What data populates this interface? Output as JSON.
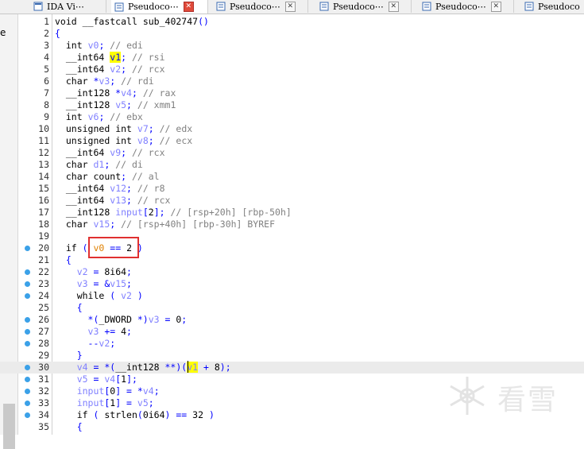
{
  "tabs": [
    {
      "label": "IDA Vi⋯",
      "active": false
    },
    {
      "label": "Pseudoco⋯",
      "active": true
    },
    {
      "label": "Pseudoco⋯",
      "active": false
    },
    {
      "label": "Pseudoco⋯",
      "active": false
    },
    {
      "label": "Pseudoco⋯",
      "active": false
    },
    {
      "label": "Pseudoco",
      "active": false
    }
  ],
  "left_panel_label": "e",
  "watermark": "看雪",
  "lines": [
    {
      "n": "1",
      "bp": false,
      "text": "void __fastcall sub_402747()"
    },
    {
      "n": "2",
      "bp": false,
      "text": "{"
    },
    {
      "n": "3",
      "bp": false,
      "text": "  int v0; // edi"
    },
    {
      "n": "4",
      "bp": false,
      "text": "  __int64 v1; // rsi"
    },
    {
      "n": "5",
      "bp": false,
      "text": "  __int64 v2; // rcx"
    },
    {
      "n": "6",
      "bp": false,
      "text": "  char *v3; // rdi"
    },
    {
      "n": "7",
      "bp": false,
      "text": "  __int128 *v4; // rax"
    },
    {
      "n": "8",
      "bp": false,
      "text": "  __int128 v5; // xmm1"
    },
    {
      "n": "9",
      "bp": false,
      "text": "  int v6; // ebx"
    },
    {
      "n": "10",
      "bp": false,
      "text": "  unsigned int v7; // edx"
    },
    {
      "n": "11",
      "bp": false,
      "text": "  unsigned int v8; // ecx"
    },
    {
      "n": "12",
      "bp": false,
      "text": "  __int64 v9; // rcx"
    },
    {
      "n": "13",
      "bp": false,
      "text": "  char d1; // di"
    },
    {
      "n": "14",
      "bp": false,
      "text": "  char count; // al"
    },
    {
      "n": "15",
      "bp": false,
      "text": "  __int64 v12; // r8"
    },
    {
      "n": "16",
      "bp": false,
      "text": "  __int64 v13; // rcx"
    },
    {
      "n": "17",
      "bp": false,
      "text": "  __int128 input[2]; // [rsp+20h] [rbp-50h]"
    },
    {
      "n": "18",
      "bp": false,
      "text": "  char v15; // [rsp+40h] [rbp-30h] BYREF"
    },
    {
      "n": "19",
      "bp": false,
      "text": ""
    },
    {
      "n": "20",
      "bp": true,
      "text": "  if ( v0 == 2 )"
    },
    {
      "n": "21",
      "bp": false,
      "text": "  {"
    },
    {
      "n": "22",
      "bp": true,
      "text": "    v2 = 8i64;"
    },
    {
      "n": "23",
      "bp": true,
      "text": "    v3 = &v15;"
    },
    {
      "n": "24",
      "bp": true,
      "text": "    while ( v2 )"
    },
    {
      "n": "25",
      "bp": false,
      "text": "    {"
    },
    {
      "n": "26",
      "bp": true,
      "text": "      *(_DWORD *)v3 = 0;"
    },
    {
      "n": "27",
      "bp": true,
      "text": "      v3 += 4;"
    },
    {
      "n": "28",
      "bp": true,
      "text": "      --v2;"
    },
    {
      "n": "29",
      "bp": false,
      "text": "    }"
    },
    {
      "n": "30",
      "bp": true,
      "text": "    v4 = *(__int128 **)(v1 + 8);"
    },
    {
      "n": "31",
      "bp": true,
      "text": "    v5 = v4[1];"
    },
    {
      "n": "32",
      "bp": true,
      "text": "    input[0] = *v4;"
    },
    {
      "n": "33",
      "bp": true,
      "text": "    input[1] = v5;"
    },
    {
      "n": "34",
      "bp": true,
      "text": "    if ( strlen(0i64) == 32 )"
    },
    {
      "n": "35",
      "bp": false,
      "text": "    {"
    }
  ]
}
